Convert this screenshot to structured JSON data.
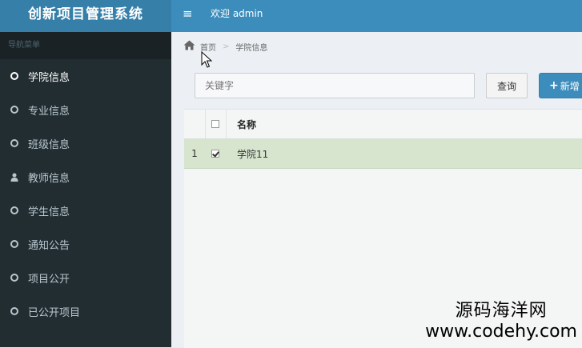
{
  "header": {
    "brand": "创新项目管理系统",
    "menu_icon": "hamburger-icon",
    "welcome": "欢迎 admin"
  },
  "sidebar": {
    "title": "导航菜单",
    "items": [
      {
        "label": "学院信息",
        "icon": "circle-icon",
        "active": true
      },
      {
        "label": "专业信息",
        "icon": "circle-icon"
      },
      {
        "label": "班级信息",
        "icon": "circle-icon"
      },
      {
        "label": "教师信息",
        "icon": "person-icon"
      },
      {
        "label": "学生信息",
        "icon": "circle-icon"
      },
      {
        "label": "通知公告",
        "icon": "circle-icon"
      },
      {
        "label": "项目公开",
        "icon": "circle-icon"
      },
      {
        "label": "已公开项目",
        "icon": "circle-icon"
      }
    ]
  },
  "breadcrumb": {
    "home": "首页",
    "separator": ">",
    "current": "学院信息"
  },
  "toolbar": {
    "search_placeholder": "关键字",
    "search_label": "查询",
    "add_label": "新增"
  },
  "table": {
    "header": {
      "name": "名称"
    },
    "rows": [
      {
        "index": "1",
        "name": "学院11",
        "checked": true
      }
    ]
  },
  "watermark": {
    "cn": "源码海洋网",
    "url": "www.codehy.com"
  },
  "colors": {
    "header": "#3c8dbc",
    "brand": "#367fa9",
    "sidebar": "#222d32",
    "selected_row": "#d7e5cf"
  }
}
